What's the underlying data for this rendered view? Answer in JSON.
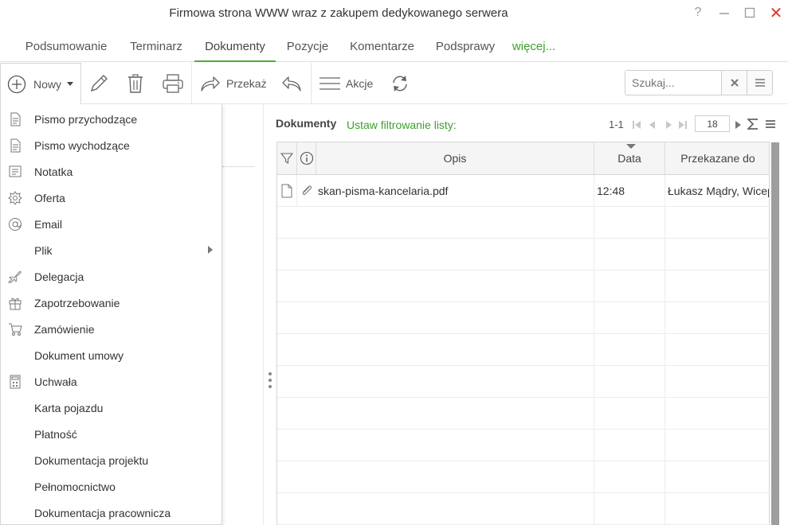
{
  "window": {
    "title": "Firmowa strona WWW wraz z zakupem dedykowanego serwera",
    "help": "?",
    "close": "✕"
  },
  "tabs": [
    {
      "label": "Podsumowanie"
    },
    {
      "label": "Terminarz"
    },
    {
      "label": "Dokumenty"
    },
    {
      "label": "Pozycje"
    },
    {
      "label": "Komentarze"
    },
    {
      "label": "Podsprawy"
    },
    {
      "label": "więcej..."
    }
  ],
  "toolbar": {
    "new_label": "Nowy",
    "forward_label": "Przekaż",
    "actions_label": "Akcje",
    "search_placeholder": "Szukaj..."
  },
  "new_menu": {
    "items": [
      {
        "label": "Pismo przychodzące",
        "icon": "document-icon"
      },
      {
        "label": "Pismo wychodzące",
        "icon": "document-icon"
      },
      {
        "label": "Notatka",
        "icon": "note-icon"
      },
      {
        "label": "Oferta",
        "icon": "badge-icon"
      },
      {
        "label": "Email",
        "icon": "at-icon"
      },
      {
        "label": "Plik",
        "icon": "",
        "submenu": true
      },
      {
        "label": "Delegacja",
        "icon": "plane-icon"
      },
      {
        "label": "Zapotrzebowanie",
        "icon": "gift-icon"
      },
      {
        "label": "Zamówienie",
        "icon": "cart-icon"
      },
      {
        "label": "Dokument umowy",
        "icon": ""
      },
      {
        "label": "Uchwała",
        "icon": "calculator-icon"
      },
      {
        "label": "Karta pojazdu",
        "icon": ""
      },
      {
        "label": "Płatność",
        "icon": ""
      },
      {
        "label": "Dokumentacja projektu",
        "icon": ""
      },
      {
        "label": "Pełnomocnictwo",
        "icon": ""
      },
      {
        "label": "Dokumentacja pracownicza",
        "icon": ""
      }
    ]
  },
  "documents": {
    "title": "Dokumenty",
    "filter_link": "Ustaw filtrowanie listy:",
    "range": "1-1",
    "page_size": "18",
    "columns": [
      "Opis",
      "Data",
      "Przekazane do"
    ],
    "rows": [
      {
        "description": "skan-pisma-kancelaria.pdf",
        "date": "12:48",
        "forwarded_to": "Łukasz Mądry, Wicep"
      }
    ]
  },
  "colors": {
    "accent_green": "#3ea02e",
    "tab_underline": "#4caf2f",
    "close_red": "#e03a2e"
  }
}
